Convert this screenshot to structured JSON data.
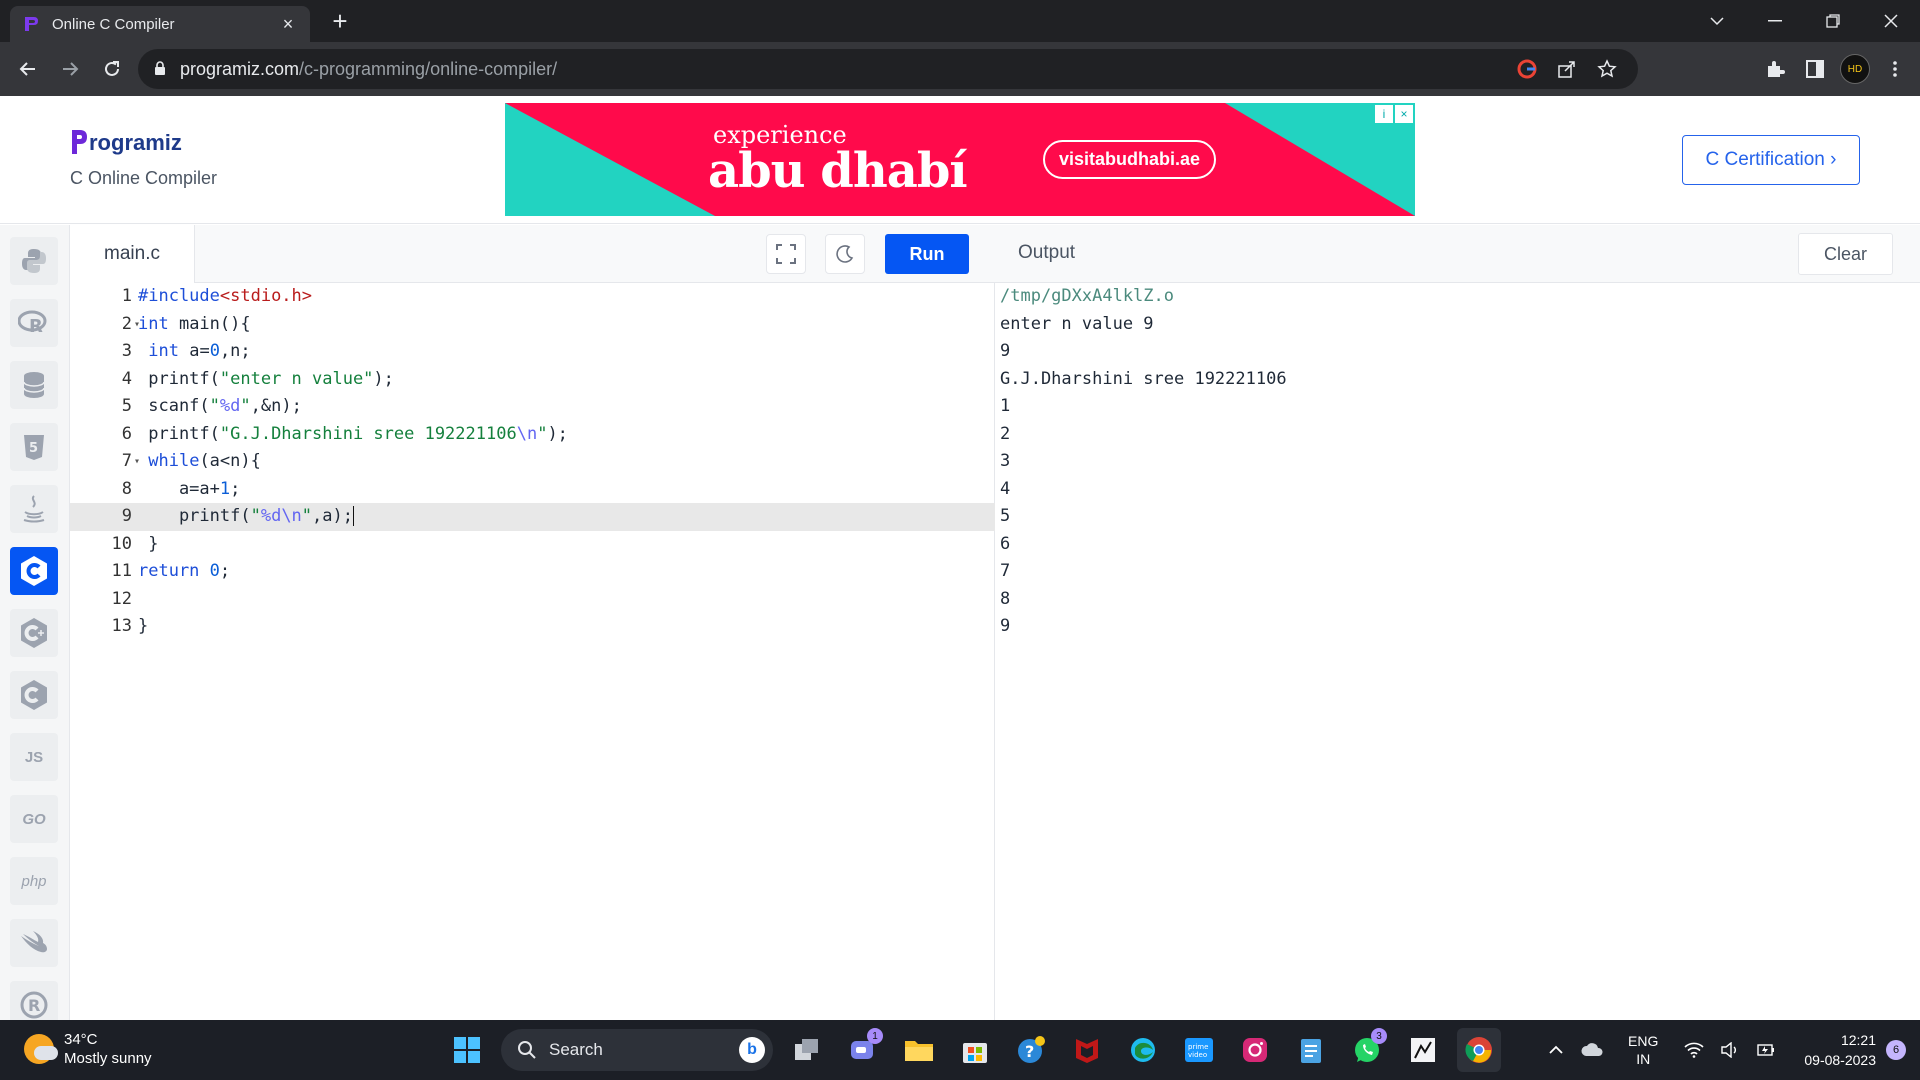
{
  "browser": {
    "tab_title": "Online C Compiler",
    "tab_close": "×",
    "new_tab": "+",
    "url_host": "programiz.com",
    "url_path": "/c-programming/online-compiler/"
  },
  "site": {
    "logo_text": "rogramiz",
    "subtitle": "C Online Compiler",
    "certification_button": "C Certification ›"
  },
  "ad": {
    "line1": "experience",
    "line2": "abu dhabí",
    "url": "visitabudhabi.ae",
    "info_icon": "i",
    "close_icon": "×",
    "colors": {
      "background": "#ff0a4b",
      "accent": "#22d3c1"
    }
  },
  "sidebar": {
    "languages": [
      {
        "name": "python-icon",
        "label": "Py"
      },
      {
        "name": "r-icon",
        "label": "R"
      },
      {
        "name": "sql-icon",
        "label": "SQL"
      },
      {
        "name": "html-icon",
        "label": "5"
      },
      {
        "name": "java-icon",
        "label": "☕"
      },
      {
        "name": "c-icon",
        "label": "C"
      },
      {
        "name": "cpp-icon",
        "label": "C+"
      },
      {
        "name": "csharp-icon",
        "label": "C#"
      },
      {
        "name": "javascript-icon",
        "label": "JS"
      },
      {
        "name": "go-icon",
        "label": "GO"
      },
      {
        "name": "php-icon",
        "label": "php"
      },
      {
        "name": "swift-icon",
        "label": "⟋"
      },
      {
        "name": "rust-icon",
        "label": "R"
      }
    ]
  },
  "editor": {
    "file_name": "main.c",
    "run_label": "Run",
    "lines": [
      "#include<stdio.h>",
      "int main(){",
      " int a=0,n;",
      " printf(\"enter n value\");",
      " scanf(\"%d\",&n);",
      " printf(\"G.J.Dharshini sree 192221106\\n\");",
      " while(a<n){",
      "    a=a+1;",
      "    printf(\"%d\\n\",a);",
      " }",
      "return 0;",
      "",
      "}"
    ],
    "line_numbers": [
      "1",
      "2",
      "3",
      "4",
      "5",
      "6",
      "7",
      "8",
      "9",
      "10",
      "11",
      "12",
      "13"
    ]
  },
  "output": {
    "title": "Output",
    "clear_label": "Clear",
    "lines": [
      "/tmp/gDXxA4lklZ.o",
      "enter n value 9",
      "9",
      "G.J.Dharshini sree 192221106",
      "1",
      "2",
      "3",
      "4",
      "5",
      "6",
      "7",
      "8",
      "9"
    ]
  },
  "taskbar": {
    "temperature": "34°C",
    "weather": "Mostly sunny",
    "search_placeholder": "Search",
    "teams_badge": "1",
    "whatsapp_badge": "3",
    "lang_top": "ENG",
    "lang_bottom": "IN",
    "time": "12:21",
    "date": "09-08-2023",
    "notification_count": "6"
  }
}
